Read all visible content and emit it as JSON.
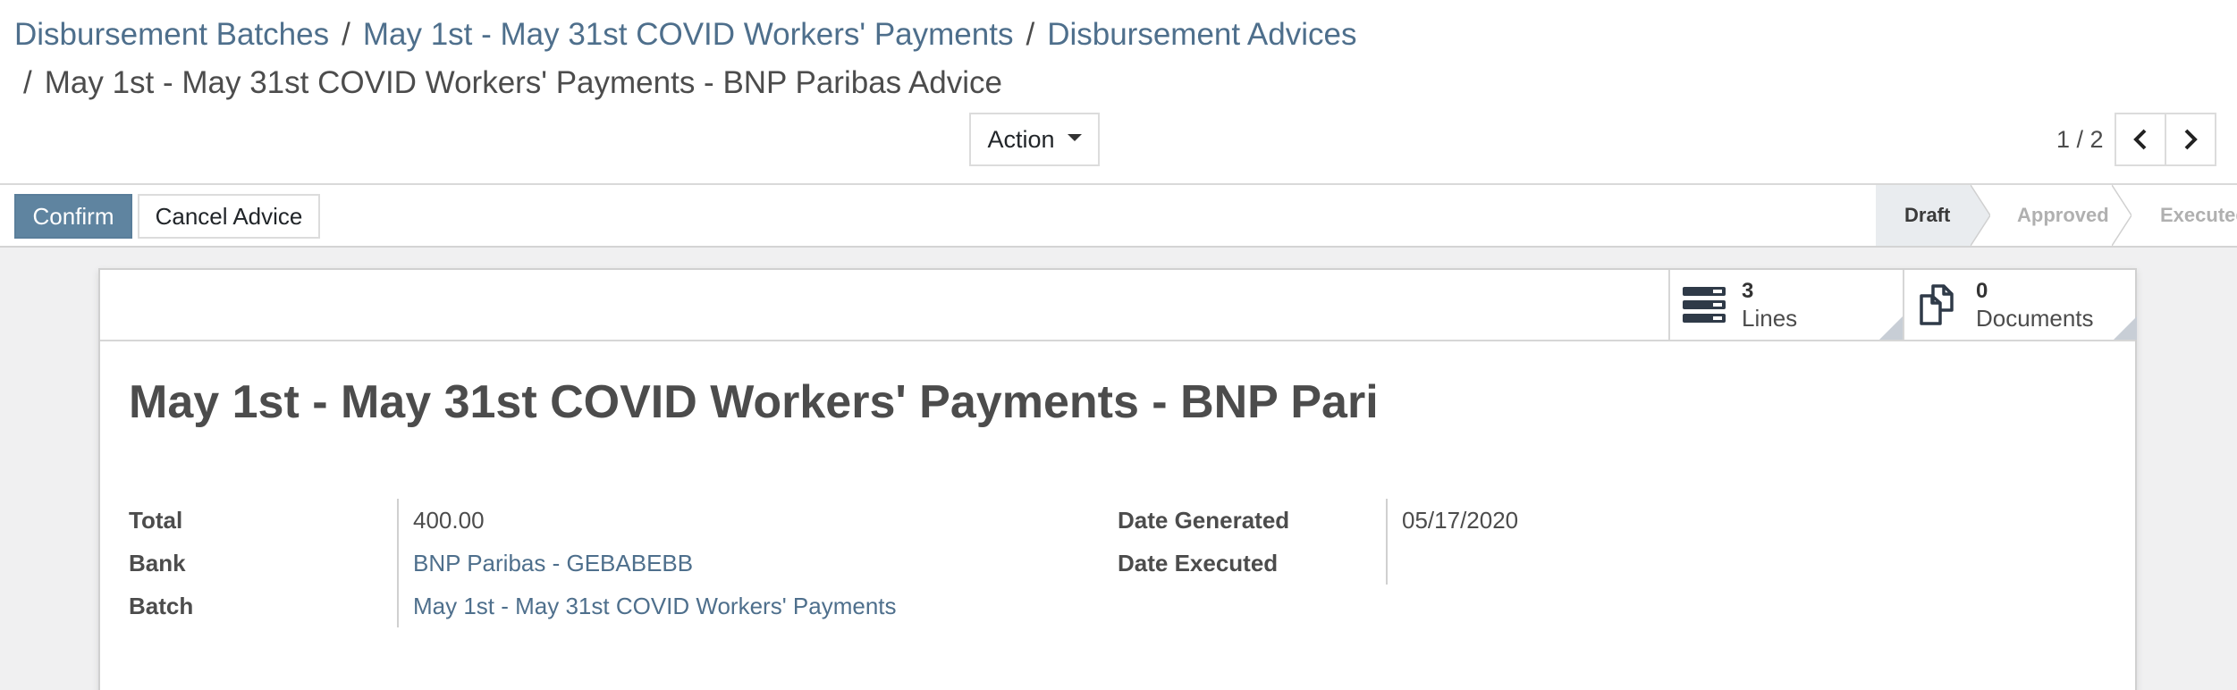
{
  "breadcrumb": {
    "items": [
      "Disbursement Batches",
      "May 1st - May 31st COVID Workers' Payments",
      "Disbursement Advices"
    ],
    "current": "May 1st - May 31st COVID Workers' Payments - BNP Paribas Advice",
    "separator": "/"
  },
  "toolbar": {
    "action_label": "Action"
  },
  "pager": {
    "value": "1 / 2"
  },
  "statusbar": {
    "confirm_label": "Confirm",
    "cancel_label": "Cancel Advice",
    "stages": [
      "Draft",
      "Approved",
      "Executed"
    ],
    "active_stage": "Draft"
  },
  "stat_buttons": {
    "lines": {
      "value": "3",
      "label": "Lines"
    },
    "documents": {
      "value": "0",
      "label": "Documents"
    }
  },
  "record": {
    "title": "May 1st - May 31st COVID Workers' Payments - BNP Pari…",
    "fields_left": [
      {
        "label": "Total",
        "value": "400.00"
      },
      {
        "label": "Bank",
        "value": "BNP Paribas - GEBABEBB"
      },
      {
        "label": "Batch",
        "value": "May 1st - May 31st COVID Workers' Payments"
      }
    ],
    "fields_right": [
      {
        "label": "Date Generated",
        "value": "05/17/2020"
      },
      {
        "label": "Date Executed",
        "value": ""
      }
    ]
  },
  "colors": {
    "primary": "#5f84a0",
    "link": "#4e6f8c",
    "text": "#4c4c4c",
    "active_stage_bg": "#e9ecef"
  },
  "icons": [
    "caret-down-icon",
    "chevron-left-icon",
    "chevron-right-icon",
    "list-lines-icon",
    "documents-icon"
  ]
}
